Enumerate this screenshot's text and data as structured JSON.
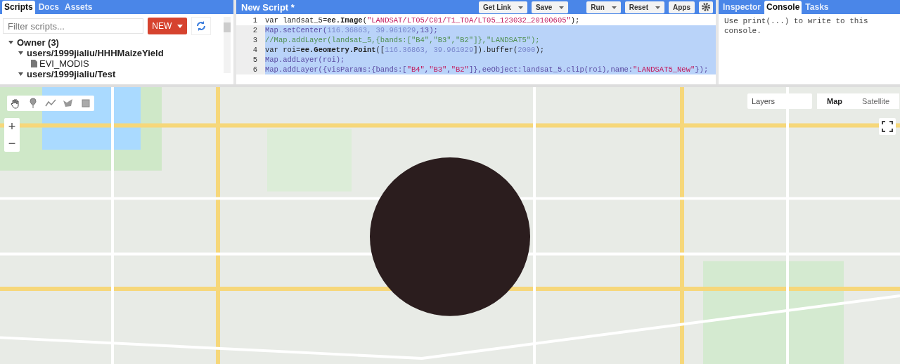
{
  "left_panel": {
    "tabs": [
      {
        "label": "Scripts",
        "selected": true
      },
      {
        "label": "Docs",
        "selected": false
      },
      {
        "label": "Assets",
        "selected": false
      }
    ],
    "filter": {
      "placeholder": "Filter scripts..."
    },
    "new_button": "NEW",
    "tree": [
      {
        "label": "Owner (3)",
        "expanded": true,
        "children": [
          {
            "label": "users/1999jialiu/HHHMaizeYield",
            "expanded": true,
            "children": [
              {
                "label": "EVI_MODIS",
                "kind": "file"
              }
            ]
          },
          {
            "label": "users/1999jialiu/Test",
            "expanded": true
          }
        ]
      }
    ]
  },
  "editor": {
    "title": "New Script *",
    "buttons": [
      {
        "label": "Get Link",
        "dropdown": true
      },
      {
        "label": "Save",
        "dropdown": true
      },
      {
        "label": "Run",
        "dropdown": true
      },
      {
        "label": "Reset",
        "dropdown": true
      },
      {
        "label": "Apps",
        "dropdown": false
      }
    ],
    "lines": [
      {
        "number": "1",
        "selected": false,
        "tokens": [
          {
            "t": "var landsat_5=",
            "kind": "plain"
          },
          {
            "t": "ee.Image",
            "kind": "bold"
          },
          {
            "t": "(",
            "kind": "plain"
          },
          {
            "t": "\"LANDSAT/LT05/C01/T1_TOA/LT05_123032_20100605\"",
            "kind": "str"
          },
          {
            "t": ");",
            "kind": "plain"
          }
        ]
      },
      {
        "number": "2",
        "selected": true,
        "tokens": [
          {
            "t": "Map.setCenter(",
            "kind": "fn"
          },
          {
            "t": "116.36863, 39.961029",
            "kind": "num"
          },
          {
            "t": ",13);",
            "kind": "fn"
          }
        ]
      },
      {
        "number": "3",
        "selected": true,
        "tokens": [
          {
            "t": "//Map.addLayer(landsat_5,{bands:[\"B4\",\"B3\",\"B2\"]},\"LANDSAT5\");",
            "kind": "comment"
          }
        ]
      },
      {
        "number": "4",
        "selected": true,
        "tokens": [
          {
            "t": "var roi=",
            "kind": "plain"
          },
          {
            "t": "ee.Geometry.Point",
            "kind": "bold"
          },
          {
            "t": "([",
            "kind": "plain"
          },
          {
            "t": "116.36863, 39.961029",
            "kind": "num"
          },
          {
            "t": "]).buffer(",
            "kind": "plain"
          },
          {
            "t": "2000",
            "kind": "num"
          },
          {
            "t": ");",
            "kind": "plain"
          }
        ]
      },
      {
        "number": "5",
        "selected": true,
        "tokens": [
          {
            "t": "Map.addLayer(roi);",
            "kind": "fn"
          }
        ]
      },
      {
        "number": "6",
        "selected": true,
        "tokens": [
          {
            "t": "Map.addLayer({visParams:{bands:[",
            "kind": "fn"
          },
          {
            "t": "\"B4\"",
            "kind": "str"
          },
          {
            "t": ",",
            "kind": "fn"
          },
          {
            "t": "\"B3\"",
            "kind": "str"
          },
          {
            "t": ",",
            "kind": "fn"
          },
          {
            "t": "\"B2\"",
            "kind": "str"
          },
          {
            "t": "]},eeObject:landsat_5.clip(roi),name:",
            "kind": "fn"
          },
          {
            "t": "\"LANDSAT5_New\"",
            "kind": "str"
          },
          {
            "t": "});",
            "kind": "fn"
          }
        ]
      }
    ]
  },
  "right_panel": {
    "tabs": [
      {
        "label": "Inspector",
        "selected": false
      },
      {
        "label": "Console",
        "selected": true
      },
      {
        "label": "Tasks",
        "selected": false
      }
    ],
    "console_text": "Use print(...) to write to this console."
  },
  "map": {
    "layers_label": "Layers",
    "map_types": [
      {
        "label": "Map",
        "selected": true
      },
      {
        "label": "Satellite",
        "selected": false
      }
    ],
    "zoom_in": "+",
    "zoom_out": "−"
  }
}
